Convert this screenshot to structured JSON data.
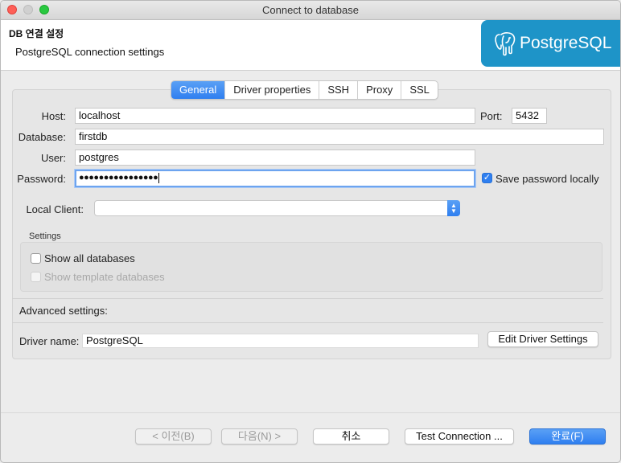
{
  "window": {
    "title": "Connect to database"
  },
  "header": {
    "title": "DB 연결 설정",
    "description": "PostgreSQL connection settings",
    "logo_text": "PostgreSQL",
    "logo_color": "#1e94c8"
  },
  "tabs": [
    "General",
    "Driver properties",
    "SSH",
    "Proxy",
    "SSL"
  ],
  "active_tab": "General",
  "form": {
    "host_label": "Host:",
    "host_value": "localhost",
    "port_label": "Port:",
    "port_value": "5432",
    "database_label": "Database:",
    "database_value": "firstdb",
    "user_label": "User:",
    "user_value": "postgres",
    "password_label": "Password:",
    "password_value": "●●●●●●●●●●●●●●●●",
    "save_password_label": "Save password locally",
    "save_password_checked": true,
    "local_client_label": "Local Client:",
    "local_client_value": ""
  },
  "settings": {
    "title": "Settings",
    "show_all_databases": "Show all databases",
    "show_template_databases": "Show template databases"
  },
  "advanced": {
    "title": "Advanced settings:",
    "driver_name_label": "Driver name:",
    "driver_name_value": "PostgreSQL",
    "edit_driver_button": "Edit Driver Settings"
  },
  "footer": {
    "prev_button": "< 이전(B)",
    "next_button": "다음(N) >",
    "cancel_button": "취소",
    "test_button": "Test Connection ...",
    "finish_button": "완료(F)"
  },
  "colors": {
    "accent": "#2f7ff0"
  }
}
